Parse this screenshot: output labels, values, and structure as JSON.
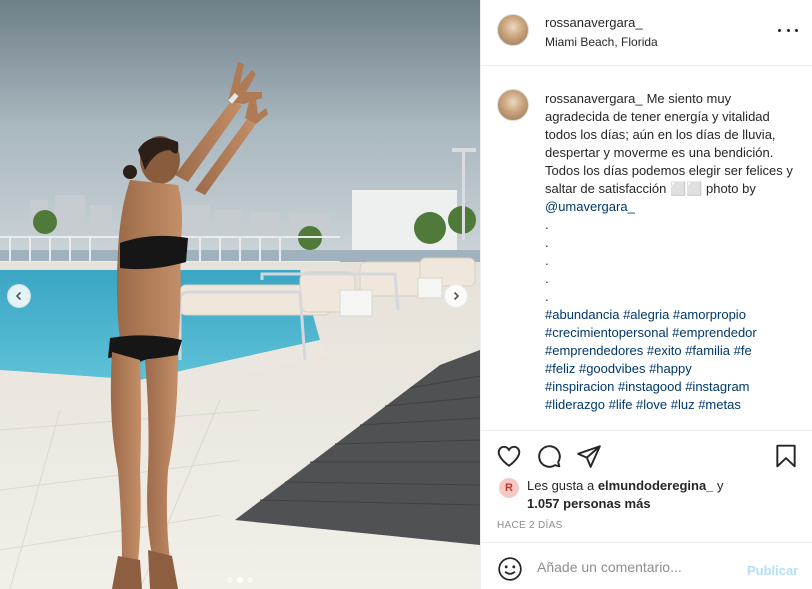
{
  "post": {
    "author": "rossanavergara_",
    "location": "Miami Beach, Florida",
    "avatar_icon": "profile-avatar",
    "photo": {
      "carousel_total": 3,
      "carousel_active": 2
    }
  },
  "caption": {
    "username": "rossanavergara_",
    "text_main": "Me siento muy agradecida de tener energía y vitalidad todos los días; aún en los días de lluvia, despertar y moverme es una bendición. Todos los días podemos elegir ser felices y saltar de satisfacción ⬜⬜ photo by",
    "mention": "@umavergara_",
    "dots": [
      ".",
      ".",
      ".",
      ".",
      "."
    ],
    "hashtag_lines": [
      "#abundancia #alegria #amorpropio",
      "#crecimientopersonal #emprendedor",
      "#emprendedores #exito #familia #fe",
      "#feliz #goodvibes #happy",
      "#inspiracion #instagood #instagram",
      "#liderazgo #life #love #luz #metas"
    ]
  },
  "actions": {
    "like_icon": "heart-icon",
    "comment_icon": "comment-icon",
    "share_icon": "share-icon",
    "save_icon": "bookmark-icon"
  },
  "likes": {
    "prefix": "Les gusta a ",
    "liker": "elmundoderegina_",
    "conjunction": " y",
    "others_count": "1.057 personas más",
    "liker_badge": "R"
  },
  "timestamp": "HACE 2 DÍAS",
  "comment": {
    "placeholder": "Añade un comentario...",
    "publish_label": "Publicar"
  },
  "colors": {
    "link": "#00376b",
    "publish_disabled": "#b2dffc",
    "muted": "#8e8e8e",
    "border": "#efefef"
  }
}
